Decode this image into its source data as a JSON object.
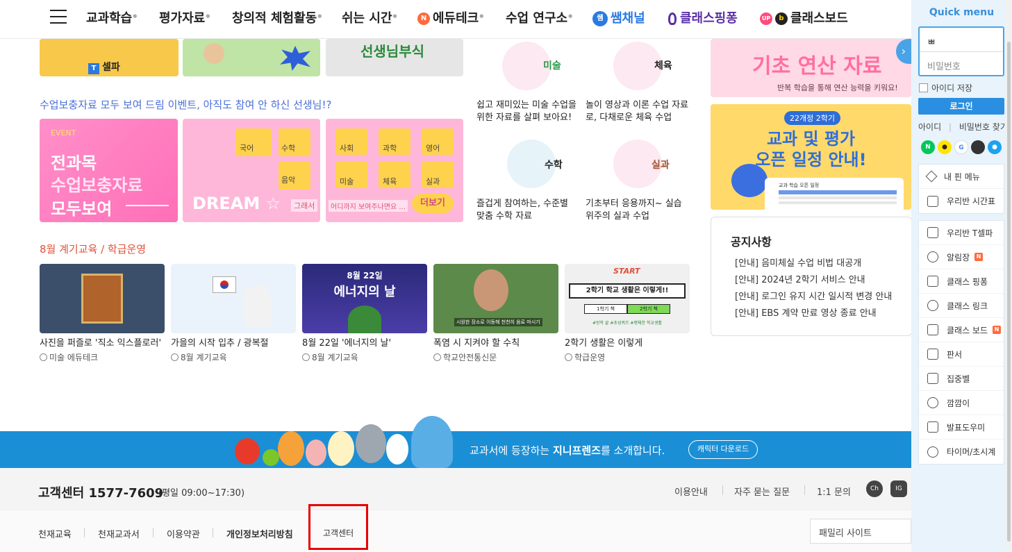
{
  "nav": {
    "items": [
      "교과학습",
      "평가자료",
      "창의적 체험활동",
      "쉬는 시간",
      "에듀테크",
      "수업 연구소",
      "쌤채널",
      "클래스핑퐁",
      "클래스보드"
    ],
    "edutech_badge": "N",
    "ssam_badge": "쌤",
    "up_badge": "UP",
    "board_badge": "b"
  },
  "top_banners": {
    "selpa_label": "셀파",
    "teacher_label": "선생님부식"
  },
  "subjects": [
    {
      "label": "미술",
      "desc": "쉽고 재미있는 미술 수업을 위한 자료를 살펴 보아요!"
    },
    {
      "label": "체육",
      "desc": "놀이 영상과 이론 수업 자료로, 다채로운 체육 수업"
    },
    {
      "label": "수학",
      "desc": "즐겁게 참여하는, 수준별 맞춤 수학 자료"
    },
    {
      "label": "실과",
      "desc": "기초부터 응용까지~ 실습 위주의 실과 수업"
    }
  ],
  "event_section": {
    "title": "수업보충자료 모두 보여 드림 이벤트, 아직도 참여 안 하신 선생님!?",
    "card1": {
      "tag": "EVENT",
      "line1": "전과목",
      "line2": "수업보충자료",
      "line3": "모두보여"
    },
    "card2": {
      "dream": "DREAM",
      "folders": [
        "국어",
        "수학",
        "음악"
      ],
      "tag": "그래서"
    },
    "card3": {
      "folders": [
        "사회",
        "과학",
        "영어",
        "미술",
        "체육",
        "실과"
      ],
      "tag": "어디까지 보여주나면요 ...",
      "more": "더보기"
    }
  },
  "right_banners": {
    "math_title": "기초 연산 자료",
    "math_sub": "반복 학습을 통해 연산 능력을 키워요!",
    "eval_tag": "22개정 2학기",
    "eval_line1": "교과 및 평가",
    "eval_line2": "오픈 일정 안내!",
    "eval_table_title": "교과 학습 오픈 일정"
  },
  "notice": {
    "title": "공지사항",
    "items": [
      "[안내] 음미체실 수업 비법 대공개",
      "[안내] 2024년 2학기 서비스 안내",
      "[안내] 로그인 유지 시간 일시적 변경 안내",
      "[안내] EBS 계약 만료 영상 종료 안내"
    ]
  },
  "august": {
    "title": "8월 계기교육 / 학급운영",
    "cards": [
      {
        "caption": "사진을 퍼즐로 '직소 익스플로러'",
        "meta": "미술 에듀테크"
      },
      {
        "caption": "가을의 시작 입추 / 광복절",
        "meta": "8월 계기교육"
      },
      {
        "caption": "8월 22일 '에너지의 날'",
        "meta": "8월 계기교육",
        "thumb_date": "8월 22일",
        "thumb_title": "에너지의 날"
      },
      {
        "caption": "폭염 시 지켜야 할 수칙",
        "meta": "학교안전통신문",
        "thumb_text": "시원한 장소로 이동해 천천히 음료 마시기"
      },
      {
        "caption": "2학기 생활은 이렇게",
        "meta": "학급운영",
        "thumb_start": "START",
        "thumb_title": "2학기 학교 생활은 이렇게!!",
        "thumb_left": "1학기 책",
        "thumb_right": "2학기 책",
        "thumb_tags": "#방학 끝 #초성퀴즈 #평체한 학교생활"
      }
    ]
  },
  "strip": {
    "text_pre": "교과서에 등장하는 ",
    "text_bold": "지니프렌즈",
    "text_post": "를 소개합니다.",
    "button": "캐릭터 다운로드"
  },
  "footer": {
    "cs_label": "고객센터 1577-7609",
    "cs_hours": "(평일 09:00~17:30)",
    "links": [
      "이용안내",
      "자주 묻는 질문",
      "1:1 문의"
    ],
    "sns": [
      "Ch",
      "IG"
    ],
    "bottom_links": [
      "천재교육",
      "천재교과서",
      "이용약관",
      "개인정보처리방침",
      "고객센터"
    ],
    "family_site": "패밀리 사이트"
  },
  "quick": {
    "title": "Quick menu",
    "id_value": "ㅃ",
    "pw_placeholder": "비밀번호",
    "save_id": "아이디 저장",
    "login": "로그인",
    "find_id": "아이디",
    "find_pw": "비밀번호 찾기",
    "sns": [
      "N",
      "●",
      "G",
      "",
      "●"
    ],
    "group1": [
      "내 핀 메뉴",
      "우리반 시간표"
    ],
    "group2": [
      "우리반 T셀파",
      "알림장",
      "클래스 핑퐁",
      "클래스 링크",
      "클래스 보드",
      "판서",
      "집중벨",
      "깜깜이",
      "발표도우미",
      "타이머/초시계"
    ],
    "new_badge": "N"
  }
}
